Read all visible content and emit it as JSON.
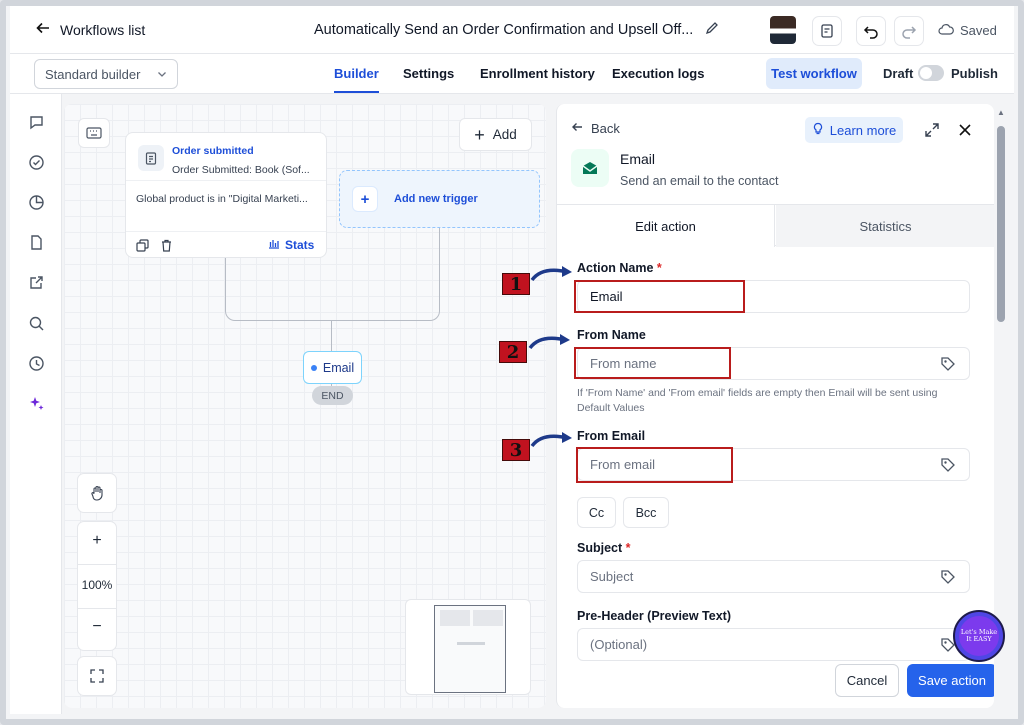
{
  "header": {
    "back_label": "Workflows list",
    "workflow_title": "Automatically Send an Order Confirmation and Upsell Off...",
    "saved_label": "Saved"
  },
  "subbar": {
    "builder_mode": "Standard builder",
    "tabs": [
      "Builder",
      "Settings",
      "Enrollment history",
      "Execution logs"
    ],
    "active_tab": "Builder",
    "test_button": "Test workflow",
    "draft_label": "Draft",
    "publish_label": "Publish"
  },
  "rail_icons": [
    "chat-icon",
    "check-circle-icon",
    "pie-chart-icon",
    "file-icon",
    "external-link-icon",
    "search-icon",
    "history-icon",
    "sparkle-icon"
  ],
  "canvas": {
    "add_label": "Add",
    "trigger": {
      "title": "Order submitted",
      "subtitle": "Order Submitted: Book (Sof...",
      "filter": "Global product is in \"Digital Marketi...",
      "stats_label": "Stats"
    },
    "add_trigger_label": "Add new trigger",
    "action_node": "Email",
    "end_label": "END",
    "zoom_level": "100%",
    "zoom_in": "+",
    "zoom_out": "−"
  },
  "panel": {
    "back_label": "Back",
    "learn_more": "Learn more",
    "action_title": "Email",
    "action_desc": "Send an email to the contact",
    "tabs": [
      "Edit action",
      "Statistics"
    ],
    "fields": {
      "action_name_label": "Action Name",
      "action_name_value": "Email",
      "from_name_label": "From Name",
      "from_name_placeholder": "From name",
      "hint": "If 'From Name' and 'From email' fields are empty then Email will be sent using Default Values",
      "from_email_label": "From Email",
      "from_email_placeholder": "From email",
      "cc": "Cc",
      "bcc": "Bcc",
      "subject_label": "Subject",
      "subject_placeholder": "Subject",
      "preheader_label": "Pre-Header (Preview Text)",
      "preheader_placeholder": "(Optional)",
      "required_mark": "*"
    },
    "cancel": "Cancel",
    "save": "Save action"
  },
  "annotations": [
    "1",
    "2",
    "3"
  ],
  "brand_badge": "Let's Make It EASY",
  "colors": {
    "accent": "#2563eb",
    "annotation_red": "#c1121f"
  }
}
